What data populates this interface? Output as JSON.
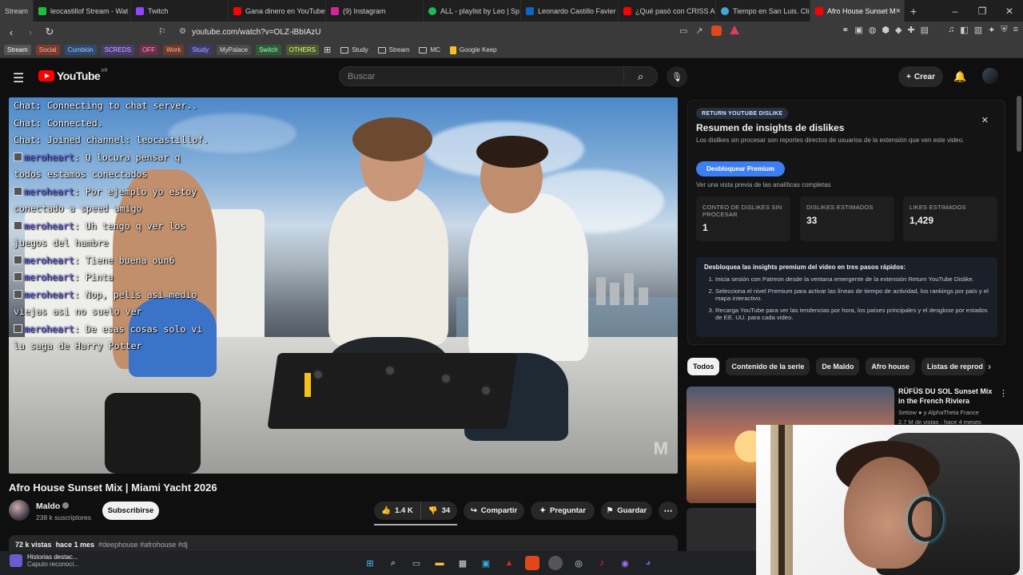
{
  "browser": {
    "tabs": [
      {
        "label": "Stream",
        "color": "#2d2d2d"
      },
      {
        "label": "leocastillof Stream - Wat",
        "color": "#19c23a"
      },
      {
        "label": "Twitch",
        "color": "#9146ff"
      },
      {
        "label": "Gana dinero en YouTube",
        "color": "#ff0000"
      },
      {
        "label": "(9) Instagram",
        "color": "#d6249f"
      },
      {
        "label": "ALL - playlist by Leo | Sp",
        "color": "#1db954"
      },
      {
        "label": "Leonardo Castillo Favier",
        "color": "#0a66c2"
      },
      {
        "label": "¿Qué pasó con CRISS AN",
        "color": "#ff0000"
      },
      {
        "label": "Tiempo en San Luis. Clim",
        "color": "#4aa3df"
      },
      {
        "label": "Afro House Sunset M",
        "color": "#ff0000"
      }
    ],
    "url": "youtube.com/watch?v=OLZ-iBbIAzU",
    "bookmarks": {
      "chips": [
        {
          "label": "Stream",
          "color": "#555555",
          "text": "#ffffff"
        },
        {
          "label": "Social",
          "color": "#7a3b2e",
          "text": "#ffb09a"
        },
        {
          "label": "Cumbión",
          "color": "#2e4b6e",
          "text": "#9cc7ff"
        },
        {
          "label": "SCREDS",
          "color": "#4a3a6e",
          "text": "#c9b3ff"
        },
        {
          "label": "OFF",
          "color": "#6b2e4a",
          "text": "#ff9cc8"
        },
        {
          "label": "Work",
          "color": "#6b3a2a",
          "text": "#ffb28a"
        },
        {
          "label": "Study",
          "color": "#3a3a6e",
          "text": "#b3b3ff"
        },
        {
          "label": "MyPalace",
          "color": "#4a4a4a",
          "text": "#dddddd"
        },
        {
          "label": "Switch",
          "color": "#2e5a3a",
          "text": "#9cffb8"
        },
        {
          "label": "OTHERS",
          "color": "#4e5a2e",
          "text": "#d8ff9c"
        }
      ],
      "folders": [
        "Study",
        "Stream",
        "MC"
      ],
      "keep": "Google Keep"
    }
  },
  "youtube": {
    "logo_text": "YouTube",
    "logo_region": "AR",
    "search_placeholder": "Buscar",
    "create_label": "Crear"
  },
  "chat": [
    {
      "user": "",
      "text": "Chat: Connecting to chat server.."
    },
    {
      "user": "",
      "text": "Chat: Connected."
    },
    {
      "user": "",
      "text": "Chat: Joined channel: leocastillof."
    },
    {
      "user": "meroheart",
      "text": ": Q locura pensar q todos estamos conectados"
    },
    {
      "user": "meroheart",
      "text": ": Por ejemplo yo estoy conectado a speed amigo"
    },
    {
      "user": "meroheart",
      "text": ": Uh tengo q ver los juegos del hambre"
    },
    {
      "user": "meroheart",
      "text": ": Tiene buena oun6"
    },
    {
      "user": "meroheart",
      "text": ": Pinta"
    },
    {
      "user": "meroheart",
      "text": ": Nop, pelis asi medio viejas asi no suelo ver"
    },
    {
      "user": "meroheart",
      "text": ": De esas cosas solo vi la saga de Harry Potter"
    }
  ],
  "video": {
    "title": "Afro House Sunset Mix | Miami Yacht 2026",
    "channel": "Maldo",
    "subscribers": "238 k suscriptores",
    "subscribe_label": "Subscribirse",
    "likes": "1.4 K",
    "dislikes": "34",
    "share_label": "Compartir",
    "ask_label": "Preguntar",
    "save_label": "Guardar",
    "views": "72 k vistas",
    "age": "hace 1 mes",
    "tags": "#deephouse #afrohouse #dj"
  },
  "dislike_panel": {
    "badge": "RETURN YOUTUBE DISLIKE",
    "title": "Resumen de insights de dislikes",
    "subtitle": "Los dislikes sin procesar son reportes directos de usuarios de la extensión que ven este video.",
    "button": "Desbloquear Premium",
    "note": "Ver una vista previa de las analíticas completas",
    "cards": [
      {
        "label": "CONTEO DE DISLIKES SIN PROCESAR",
        "value": "1"
      },
      {
        "label": "DISLIKES ESTIMADOS",
        "value": "33"
      },
      {
        "label": "LIKES ESTIMADOS",
        "value": "1,429"
      }
    ],
    "steps_title": "Desbloquea las insights premium del video en tres pasos rápidos:",
    "steps": [
      "Inicia sesión con Patreon desde la ventana emergente de la extensión Return YouTube Dislike.",
      "Selecciona el nivel Premium para activar las líneas de tiempo de actividad, los rankings por país y el mapa interactivo.",
      "Recarga YouTube para ver las tendencias por hora, los países principales y el desglose por estados de EE. UU. para cada video."
    ]
  },
  "chips": [
    "Todos",
    "Contenido de la serie",
    "De Maldo",
    "Afro house",
    "Listas de reprod"
  ],
  "recommendation": {
    "title": "RÜFÜS DU SOL Sunset Mix in the French Riviera",
    "channel": "Settow",
    "channel_extra": "y AlphaTheta France",
    "meta": "2.7 M de vistas · hace 4 meses"
  },
  "taskbar": {
    "notif_title": "Historias destac...",
    "notif_sub": "Caputo reconoci..."
  }
}
